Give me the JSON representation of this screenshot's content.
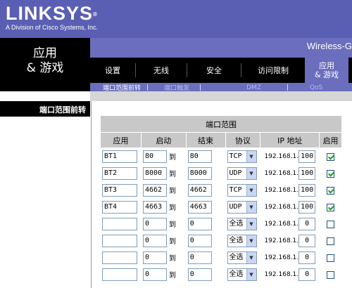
{
  "brand": {
    "logo": "LINKSYS",
    "reg": "®",
    "tagline": "A Division of Cisco Systems, Inc."
  },
  "section_title": {
    "line1": "应用",
    "line2": "& 游戏"
  },
  "product_name": "Wireless-G",
  "nav": {
    "items": [
      "设置",
      "无线",
      "安全",
      "访问限制"
    ],
    "active_line1": "应用",
    "active_line2": "& 游戏"
  },
  "subnav": {
    "items": [
      "端口范围前转",
      "端口触发",
      "DMZ",
      "QoS"
    ]
  },
  "left_subtitle": "端口范围前转",
  "table": {
    "caption": "端口范围",
    "headers": [
      "应用",
      "启动",
      "结束",
      "协议",
      "IP 地址",
      "启用"
    ],
    "to_label": "到",
    "ip_prefix": "192.168.1.",
    "rows": [
      {
        "app": "BT1",
        "start": "80",
        "end": "80",
        "protocol": "TCP",
        "ip": "100",
        "enabled": true
      },
      {
        "app": "BT2",
        "start": "8000",
        "end": "8000",
        "protocol": "UDP",
        "ip": "100",
        "enabled": true
      },
      {
        "app": "BT3",
        "start": "4662",
        "end": "4662",
        "protocol": "TCP",
        "ip": "100",
        "enabled": true
      },
      {
        "app": "BT4",
        "start": "4663",
        "end": "4663",
        "protocol": "UDP",
        "ip": "100",
        "enabled": true
      },
      {
        "app": "",
        "start": "0",
        "end": "0",
        "protocol": "全选",
        "ip": "0",
        "enabled": false
      },
      {
        "app": "",
        "start": "0",
        "end": "0",
        "protocol": "全选",
        "ip": "0",
        "enabled": false
      },
      {
        "app": "",
        "start": "0",
        "end": "0",
        "protocol": "全选",
        "ip": "0",
        "enabled": false
      },
      {
        "app": "",
        "start": "0",
        "end": "0",
        "protocol": "全选",
        "ip": "0",
        "enabled": false
      }
    ]
  },
  "colors": {
    "brand_blue": "#5b5fb3",
    "nav_active": "#6a6ebd",
    "check_green": "#21a121"
  }
}
